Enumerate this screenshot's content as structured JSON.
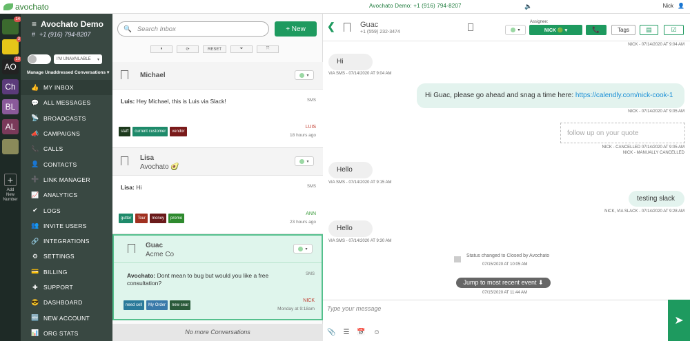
{
  "topbar": {
    "brand": "avochato",
    "center": "Avochato Demo: +1 (916) 794-8207",
    "volume": "🔈",
    "user": "Nick",
    "user_icon": "👤"
  },
  "rail": {
    "items": [
      {
        "label": "",
        "badge": "14",
        "color": "#3b6a2e"
      },
      {
        "label": "",
        "badge": "3",
        "color": "#e6c619"
      },
      {
        "label": "AO",
        "badge": "10",
        "color": "#222"
      },
      {
        "label": "Ch",
        "badge": "",
        "color": "#5b3b7a"
      },
      {
        "label": "BL",
        "badge": "",
        "color": "#8a5a9a"
      },
      {
        "label": "AL",
        "badge": "",
        "color": "#7a3a5a"
      },
      {
        "label": "",
        "badge": "",
        "color": "#8a8a5a"
      }
    ],
    "add_label": "Add New Number",
    "add_icon": "+"
  },
  "nav": {
    "account": "Avochato Demo",
    "menu_icon": "≡",
    "phone": "+1 (916) 794-8207",
    "hash_icon": "#",
    "status_label": "I'M UNAVAILABLE",
    "status_caret": "▾",
    "manage_label": "Manage Unaddressed Conversations ▾",
    "items": [
      {
        "label": "MY INBOX",
        "icon": "👍"
      },
      {
        "label": "ALL MESSAGES",
        "icon": "💬"
      },
      {
        "label": "BROADCASTS",
        "icon": "📡"
      },
      {
        "label": "CAMPAIGNS",
        "icon": "📣"
      },
      {
        "label": "CALLS",
        "icon": "📞"
      },
      {
        "label": "CONTACTS",
        "icon": "👤"
      },
      {
        "label": "LINK MANAGER",
        "icon": "➕"
      },
      {
        "label": "ANALYTICS",
        "icon": "📈"
      },
      {
        "label": "LOGS",
        "icon": "✔"
      },
      {
        "label": "INVITE USERS",
        "icon": "👥"
      },
      {
        "label": "INTEGRATIONS",
        "icon": "🔗"
      },
      {
        "label": "SETTINGS",
        "icon": "⚙"
      },
      {
        "label": "BILLING",
        "icon": "💳"
      },
      {
        "label": "SUPPORT",
        "icon": "✚"
      },
      {
        "label": "DASHBOARD",
        "icon": "😎"
      },
      {
        "label": "NEW ACCOUNT",
        "icon": "🆕"
      },
      {
        "label": "ORG STATS",
        "icon": "📊"
      }
    ]
  },
  "inbox": {
    "search_placeholder": "Search Inbox",
    "search_icon": "🔍",
    "new_label": "+ New",
    "tools": [
      "⏸",
      "⟳",
      "RESET",
      "⏷",
      "⤧"
    ],
    "conversations": [
      {
        "name": "Michael",
        "sub": "",
        "from": "Luis:",
        "text": "Hey Michael, this is Luis via Slack!",
        "channel": "SMS",
        "tags": [
          {
            "label": "staff",
            "color": "#1d3a1d"
          },
          {
            "label": "current customer",
            "color": "#1e8a6a"
          },
          {
            "label": "vendor",
            "color": "#7a1a1a"
          }
        ],
        "agent": "LUIS",
        "agent_color": "#c0392b",
        "ago": "18 hours ago"
      },
      {
        "name": "Lisa",
        "sub": "Avochato 🥑",
        "from": "Lisa:",
        "text": "Hi",
        "channel": "SMS",
        "tags": [
          {
            "label": "gutter",
            "color": "#1e8a6a"
          },
          {
            "label": "Tour",
            "color": "#a03020"
          },
          {
            "label": "money",
            "color": "#6a1a1a"
          },
          {
            "label": "promo",
            "color": "#2e8a2e"
          }
        ],
        "agent": "ANN",
        "agent_color": "#3a9a3a",
        "ago": "23 hours ago"
      },
      {
        "name": "Guac",
        "sub": "Acme Co",
        "from": "Avochato:",
        "text": "Dont mean to bug but would you like a free consultation?",
        "channel": "SMS",
        "tags": [
          {
            "label": "need cell",
            "color": "#2a7a9a"
          },
          {
            "label": "My Order",
            "color": "#3a7aaa"
          },
          {
            "label": "new sear",
            "color": "#2a5a3a"
          }
        ],
        "agent": "NICK",
        "agent_color": "#c0392b",
        "ago": "Monday at 9:18am"
      }
    ],
    "no_more": "No more Conversations"
  },
  "chat": {
    "back_icon": "❮",
    "contact_name": "Guac",
    "contact_phone": "+1 (559) 232-3474",
    "assignee_label": "Assignee:",
    "assignee": "NICK 🟢 ▾",
    "status_caret": "▾",
    "call_icon": "📞",
    "tags_label": "Tags",
    "note_icon": "▤",
    "check_icon": "☑",
    "messages": [
      {
        "ts": "NICK - 07/14/2020 AT 9:04 AM"
      },
      {
        "text": "Hi",
        "ts": "VIA SMS - 07/14/2020 AT 9:04 AM"
      },
      {
        "text": "Hi Guac, please go ahead and snag a time here: ",
        "link": "https://calendly.com/nick-cook-1",
        "ts": "NICK - 07/14/2020 AT 9:05 AM"
      },
      {
        "text": "follow up on your quote",
        "ts": "NICK - CANCELLED 07/14/2020 AT 9:05 AM",
        "ts2": "NICK - MANUALLY CANCELLED"
      },
      {
        "text": "Hello",
        "ts": "VIA SMS - 07/14/2020 AT 9:15 AM"
      },
      {
        "text": "testing slack",
        "ts": "NICK, VIA SLACK - 07/14/2020 AT 9:28 AM"
      },
      {
        "text": "Hello",
        "ts": "VIA SMS - 07/14/2020 AT 9:30 AM"
      }
    ],
    "status_event": "Status changed to Closed by Avochato",
    "status_ts": "07/15/2020 AT 10:05 AM",
    "jump_label": "Jump to most recent event ⬇",
    "last_ts": "07/15/2020 AT 11:44 AM",
    "compose_placeholder": "Type your message",
    "compose_icons": [
      "📎",
      "☰",
      "📅",
      "☺"
    ],
    "send_icon": "➤"
  }
}
